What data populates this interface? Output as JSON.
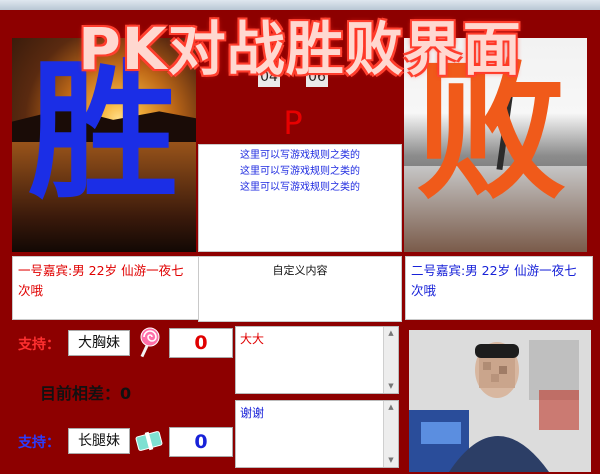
{
  "headline": "PK对战胜败界面",
  "timer": {
    "left": "04",
    "right": "06"
  },
  "pk_label": "P K",
  "result": {
    "win": "胜",
    "lose": "败"
  },
  "rules": {
    "lines": [
      "这里可以写游戏规则之类的",
      "这里可以写游戏规则之类的",
      "这里可以写游戏规则之类的"
    ]
  },
  "guests": {
    "left": "一号嘉宾:男 22岁 仙游一夜七次哦",
    "right": "二号嘉宾:男 22岁 仙游一夜七次哦"
  },
  "custom_label": "自定义内容",
  "support": {
    "top": {
      "label": "支持：",
      "name": "大胸妹",
      "score": "0",
      "icon": "lollipop-icon",
      "color": "#e00000"
    },
    "bottom": {
      "label": "支持：",
      "name": "长腿妹",
      "score": "0",
      "icon": "gift-box-icon",
      "color": "#1822d8"
    }
  },
  "difference": "目前相差：0",
  "messages": {
    "top": "大大",
    "bottom": "谢谢"
  },
  "colors": {
    "background": "#8d0000",
    "win": "#1b2ee6",
    "lose": "#f05a1a",
    "pk": "#e60000"
  }
}
